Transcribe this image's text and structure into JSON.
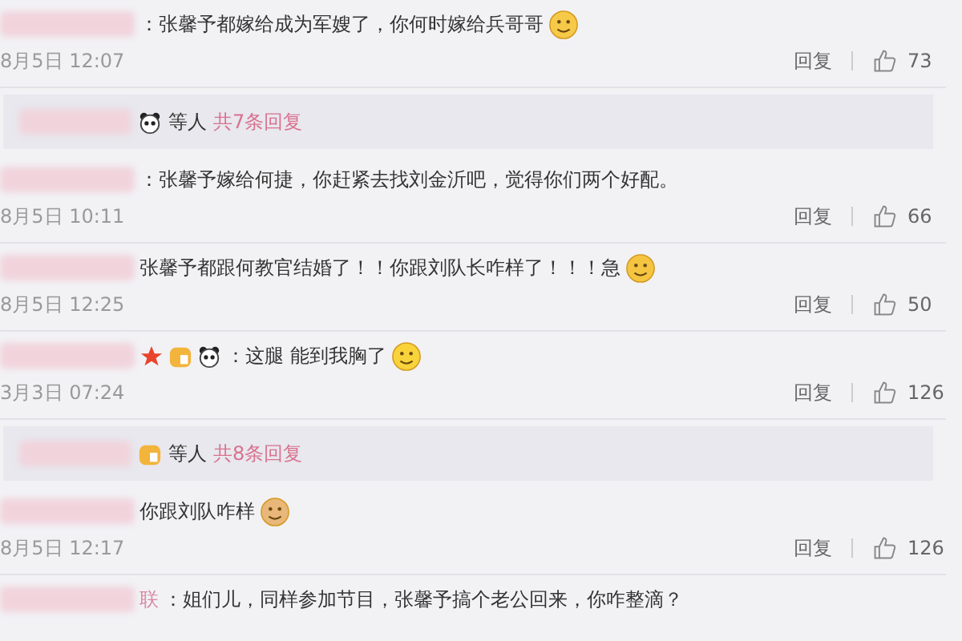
{
  "items": [
    {
      "kind": "comment",
      "text": "：张馨予都嫁给成为军嫂了，你何时嫁给兵哥哥",
      "date": "8月5日 12:07",
      "reply": "回复",
      "likes": "73"
    },
    {
      "kind": "replies",
      "others": "等人",
      "count": "共7条回复"
    },
    {
      "kind": "comment",
      "text": "：张馨予嫁给何捷，你赶紧去找刘金沂吧，觉得你们两个好配。",
      "date": "8月5日 10:11",
      "reply": "回复",
      "likes": "66"
    },
    {
      "kind": "comment",
      "text": "张馨予都跟何教官结婚了！！你跟刘队长咋样了！！！急",
      "date": "8月5日 12:25",
      "reply": "回复",
      "likes": "50"
    },
    {
      "kind": "comment",
      "text": "：这腿 能到我胸了",
      "date": "3月3日 07:24",
      "reply": "回复",
      "likes": "126"
    },
    {
      "kind": "replies",
      "others": "等人",
      "count": "共8条回复"
    },
    {
      "kind": "comment",
      "text": "你跟刘队咋样",
      "date": "8月5日 12:17",
      "reply": "回复",
      "likes": "126"
    },
    {
      "kind": "comment",
      "name_tail": "联",
      "text": "：姐们儿，同样参加节目，张馨予搞个老公回来，你咋整滴？"
    }
  ]
}
